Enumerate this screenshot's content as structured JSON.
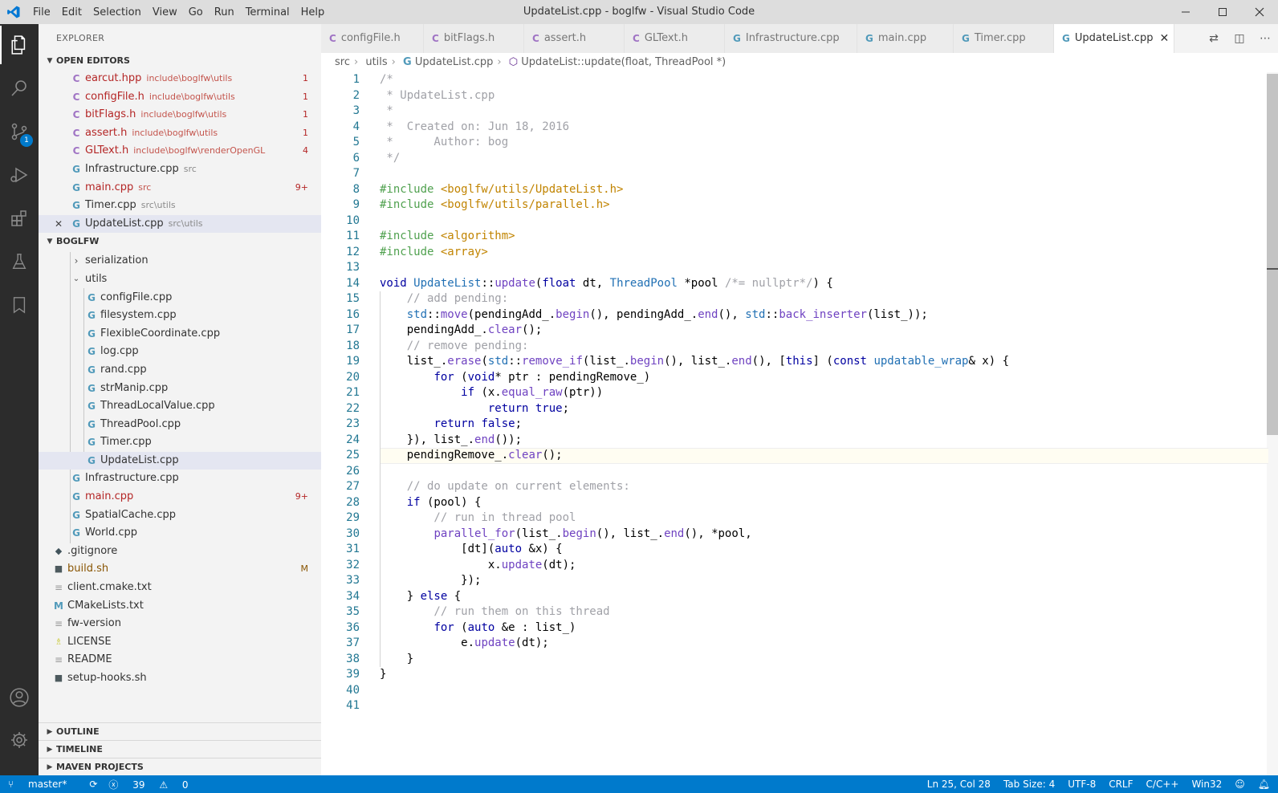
{
  "window": {
    "title": "UpdateList.cpp - boglfw - Visual Studio Code",
    "menu": [
      "File",
      "Edit",
      "Selection",
      "View",
      "Go",
      "Run",
      "Terminal",
      "Help"
    ]
  },
  "activity": {
    "scm_badge": "1"
  },
  "sidebar": {
    "title": "EXPLORER",
    "open_editors_header": "OPEN EDITORS",
    "open_editors": [
      {
        "name": "earcut.hpp",
        "path": "include\\boglfw\\utils",
        "badge": "1"
      },
      {
        "name": "configFile.h",
        "path": "include\\boglfw\\utils",
        "badge": "1"
      },
      {
        "name": "bitFlags.h",
        "path": "include\\boglfw\\utils",
        "badge": "1"
      },
      {
        "name": "assert.h",
        "path": "include\\boglfw\\utils",
        "badge": "1"
      },
      {
        "name": "GLText.h",
        "path": "include\\boglfw\\renderOpenGL",
        "badge": "4"
      },
      {
        "name": "Infrastructure.cpp",
        "path": "src",
        "badge": ""
      },
      {
        "name": "main.cpp",
        "path": "src",
        "badge": "9+"
      },
      {
        "name": "Timer.cpp",
        "path": "src\\utils",
        "badge": ""
      },
      {
        "name": "UpdateList.cpp",
        "path": "src\\utils",
        "badge": ""
      }
    ],
    "project_header": "BOGLFW",
    "tree": [
      {
        "name": "serialization",
        "badge": ""
      },
      {
        "name": "utils",
        "badge": ""
      },
      {
        "name": "configFile.cpp",
        "badge": ""
      },
      {
        "name": "filesystem.cpp",
        "badge": ""
      },
      {
        "name": "FlexibleCoordinate.cpp",
        "badge": ""
      },
      {
        "name": "log.cpp",
        "badge": ""
      },
      {
        "name": "rand.cpp",
        "badge": ""
      },
      {
        "name": "strManip.cpp",
        "badge": ""
      },
      {
        "name": "ThreadLocalValue.cpp",
        "badge": ""
      },
      {
        "name": "ThreadPool.cpp",
        "badge": ""
      },
      {
        "name": "Timer.cpp",
        "badge": ""
      },
      {
        "name": "UpdateList.cpp",
        "badge": ""
      },
      {
        "name": "Infrastructure.cpp",
        "badge": ""
      },
      {
        "name": "main.cpp",
        "badge": "9+"
      },
      {
        "name": "SpatialCache.cpp",
        "badge": ""
      },
      {
        "name": "World.cpp",
        "badge": ""
      },
      {
        "name": ".gitignore",
        "badge": ""
      },
      {
        "name": "build.sh",
        "badge": "M"
      },
      {
        "name": "client.cmake.txt",
        "badge": ""
      },
      {
        "name": "CMakeLists.txt",
        "badge": ""
      },
      {
        "name": "fw-version",
        "badge": ""
      },
      {
        "name": "LICENSE",
        "badge": ""
      },
      {
        "name": "README",
        "badge": ""
      },
      {
        "name": "setup-hooks.sh",
        "badge": ""
      }
    ],
    "bottom_sections": [
      "OUTLINE",
      "TIMELINE",
      "MAVEN PROJECTS"
    ]
  },
  "tabs": [
    "configFile.h",
    "bitFlags.h",
    "assert.h",
    "GLText.h",
    "Infrastructure.cpp",
    "main.cpp",
    "Timer.cpp",
    "UpdateList.cpp"
  ],
  "breadcrumb": [
    "src",
    "utils",
    "UpdateList.cpp",
    "UpdateList::update(float, ThreadPool *)"
  ],
  "editor": {
    "current_line": 25,
    "lines": [
      "/*",
      " * UpdateList.cpp",
      " *",
      " *  Created on: Jun 18, 2016",
      " *      Author: bog",
      " */",
      "",
      "#include <boglfw/utils/UpdateList.h>",
      "#include <boglfw/utils/parallel.h>",
      "",
      "#include <algorithm>",
      "#include <array>",
      "",
      "void UpdateList::update(float dt, ThreadPool *pool /*= nullptr*/) {",
      "    // add pending:",
      "    std::move(pendingAdd_.begin(), pendingAdd_.end(), std::back_inserter(list_));",
      "    pendingAdd_.clear();",
      "    // remove pending:",
      "    list_.erase(std::remove_if(list_.begin(), list_.end(), [this] (const updatable_wrap& x) {",
      "        for (void* ptr : pendingRemove_)",
      "            if (x.equal_raw(ptr))",
      "                return true;",
      "        return false;",
      "    }), list_.end());",
      "    pendingRemove_.clear();",
      "",
      "    // do update on current elements:",
      "    if (pool) {",
      "        // run in thread pool",
      "        parallel_for(list_.begin(), list_.end(), *pool,",
      "            [dt](auto &x) {",
      "                x.update(dt);",
      "            });",
      "    } else {",
      "        // run them on this thread",
      "        for (auto &e : list_)",
      "            e.update(dt);",
      "    }",
      "}",
      "",
      ""
    ]
  },
  "status": {
    "branch": "master*",
    "errors": "39",
    "warnings": "0",
    "position": "Ln 25, Col 28",
    "tab_size": "Tab Size: 4",
    "encoding": "UTF-8",
    "eol": "CRLF",
    "language": "C/C++",
    "config": "Win32"
  },
  "colors": {
    "accent": "#007acc",
    "error_text": "#b42626",
    "line_number": "#237893"
  }
}
